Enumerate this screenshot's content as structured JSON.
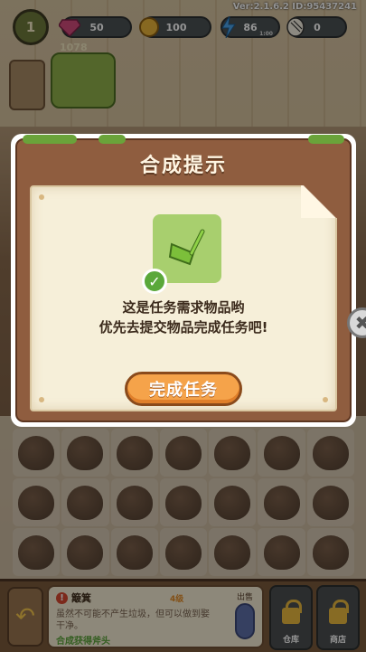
{
  "hud": {
    "level": "1",
    "gems": "50",
    "coins": "100",
    "energy": "86",
    "energy_timer": "1:00",
    "seeds": "0",
    "coin_total": "1078",
    "version": "Ver:2.1.6.2 ID:95437241"
  },
  "modal": {
    "title": "合成提示",
    "item_icon": "dustpan-icon",
    "message_line1": "这是任务需求物品哟",
    "message_line2": "优先去提交物品完成任务吧!",
    "button_label": "完成任务"
  },
  "info_panel": {
    "item_name": "簸箕",
    "item_level": "4级",
    "sell_label": "出售",
    "description": "虽然不可能不产生垃圾，但可以做到娶干净。",
    "hint": "合成获得斧头"
  },
  "bottom_buttons": {
    "warehouse": "仓库",
    "shop": "商店"
  },
  "colors": {
    "modal_brown": "#8f5d3f",
    "paper": "#f6efd9",
    "button_orange": "#f5a34a",
    "item_green": "#a8cf6e"
  }
}
